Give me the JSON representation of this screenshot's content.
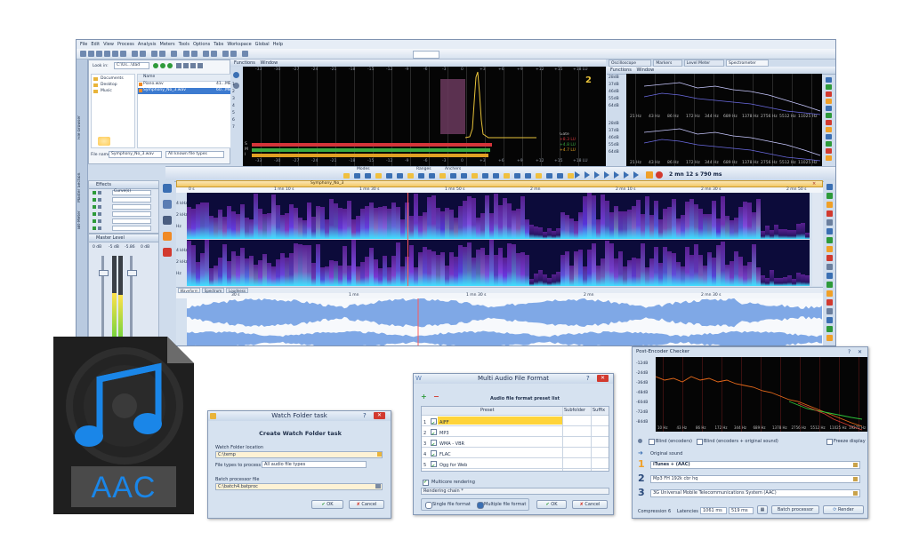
{
  "menu": [
    "File",
    "Edit",
    "View",
    "Process",
    "Analysis",
    "Meters",
    "Tools",
    "Options",
    "Tabs",
    "Workspace",
    "Global",
    "Help"
  ],
  "browser": {
    "look_in_label": "Look in:",
    "look_in_value": "C:\\Us...\\dad",
    "tree": [
      "Documents",
      "Desktop",
      "Music"
    ],
    "col_name": "Name",
    "files": [
      {
        "name": "Piano.wav",
        "size": "41...MB"
      },
      {
        "name": "Symphony_No_3.wav",
        "size": "60...MB"
      }
    ],
    "file_name_label": "File name:",
    "file_name_value": "Symphony_No_3.wav",
    "file_types": "All known file types",
    "side_tab": "File browser"
  },
  "loudness": {
    "menu": [
      "Functions",
      "Window"
    ],
    "scale": [
      "-33",
      "-30",
      "-27",
      "-24",
      "-21",
      "-18",
      "-15",
      "-12",
      "-9",
      "-6",
      "-3",
      "0",
      "+3",
      "+6",
      "+9",
      "+12",
      "+15",
      "+18 LU"
    ],
    "y_ticks": [
      "1",
      "2",
      "3",
      "4",
      "5",
      "6",
      "7"
    ],
    "bars": [
      {
        "label": "S",
        "value": "+8.3 LU",
        "color": "#d4343a"
      },
      {
        "label": "M",
        "value": "+4.8 LU",
        "color": "#3aa841"
      },
      {
        "label": "I",
        "value": "+4.7 LU",
        "color": "#e0a023"
      }
    ],
    "gate_label": "Gate",
    "gate_values": [
      "+8.3 LU",
      "+4.8 LU",
      "+4.7 LU"
    ],
    "bottom_ticks": [
      "-33",
      "-30",
      "-27",
      "-24",
      "-21",
      "-18",
      "-15",
      "-12",
      "-9",
      "-6",
      "-3",
      "0",
      "+3",
      "+6",
      "+9",
      "+12",
      "+15",
      "+18 LU"
    ]
  },
  "spectrometer": {
    "tabs": [
      "Oscilloscope",
      "Markers",
      "Level Meter",
      "Spectrometer"
    ],
    "menu": [
      "Functions",
      "Window"
    ],
    "db_top": [
      "28dB",
      "37dB",
      "46dB",
      "55dB",
      "64dB"
    ],
    "db_bot": [
      "28dB",
      "37dB",
      "46dB",
      "55dB",
      "64dB"
    ],
    "freq": [
      "21 Hz",
      "43 Hz",
      "86 Hz",
      "172 Hz",
      "344 Hz",
      "689 Hz",
      "1378 Hz",
      "2756 Hz",
      "5512 Hz",
      "11025 Hz"
    ]
  },
  "transport": {
    "groups": [
      "Modes",
      "Ranges",
      "Anchers"
    ],
    "time": "2 mn 12 s 790 ms"
  },
  "effects": {
    "title": "Effects",
    "chain": "Curve(s)",
    "side_tabs": [
      "Master Section",
      "Bit-Meter"
    ]
  },
  "master": {
    "title": "Master Level",
    "scale": [
      "0 dB",
      "-5 dB",
      "-5.86",
      "0 dB"
    ]
  },
  "editor": {
    "tab": "Symphony_No_3",
    "ruler": [
      "0 s",
      "1 mn 10 s",
      "1 mn 30 s",
      "1 mn 50 s",
      "2 mn",
      "2 mn 10 s",
      "2 mn 30 s",
      "2 mn 50 s"
    ],
    "view_tabs": [
      "Waveform",
      "Spectrum",
      "Loudness"
    ],
    "wave_ruler": [
      "30 s",
      "1 mn",
      "1 mn 30 s",
      "2 mn",
      "2 mn 30 s"
    ],
    "freq_ticks": [
      "4 kHz",
      "2 kHz",
      "Hz"
    ]
  },
  "aac": {
    "label": "AAC",
    "color": "#1a86e8"
  },
  "watch": {
    "title": "Watch Folder task",
    "heading": "Create Watch Folder task",
    "folder_label": "Watch Folder location",
    "folder_value": "C:\\temp",
    "types_label": "File types to process",
    "types_value": "All audio file types",
    "batch_label": "Batch processor file",
    "batch_value": "C:\\batch4.batproc",
    "ok": "OK",
    "cancel": "Cancel"
  },
  "multi": {
    "title": "Multi Audio File Format",
    "heading": "Audio file format preset list",
    "cols": [
      "Preset",
      "Subfolder",
      "Suffix"
    ],
    "rows": [
      {
        "n": "1",
        "name": "AIFF"
      },
      {
        "n": "2",
        "name": "MP3"
      },
      {
        "n": "3",
        "name": "WMA - VBR"
      },
      {
        "n": "4",
        "name": "FLAC"
      },
      {
        "n": "5",
        "name": "Ogg for Web"
      }
    ],
    "multicore": "Multicore rendering",
    "chain": "Rendering chain *",
    "single": "Single file format",
    "multiple": "Multiple file format",
    "ok": "OK",
    "cancel": "Cancel"
  },
  "checker": {
    "title": "Post-Encoder Checker",
    "db": [
      "-12dB",
      "-24dB",
      "-36dB",
      "-48dB",
      "-60dB",
      "-72dB",
      "-84dB"
    ],
    "freq": [
      "10 Hz",
      "43 Hz",
      "86 Hz",
      "172 Hz",
      "344 Hz",
      "689 Hz",
      "1378 Hz",
      "2756 Hz",
      "5512 Hz",
      "11025 Hz",
      "19271 Hz"
    ],
    "blind": "Blind (encoders)",
    "blind2": "Blind (encoders + original sound)",
    "freeze": "Freeze display",
    "original": "Original sound",
    "encoders": [
      {
        "n": "1",
        "name": "iTunes + (AAC)"
      },
      {
        "n": "2",
        "name": "Mp3 FH 192k cbr hq"
      },
      {
        "n": "3",
        "name": "3G Universal Mobile Telecommunications System (AAC)"
      }
    ],
    "compression_label": "Compression",
    "compression_value": "6",
    "latencies_label": "Latencies",
    "latency1": "1061 ms",
    "latency2": "519 ms",
    "batch": "Batch processor",
    "render": "Render"
  }
}
